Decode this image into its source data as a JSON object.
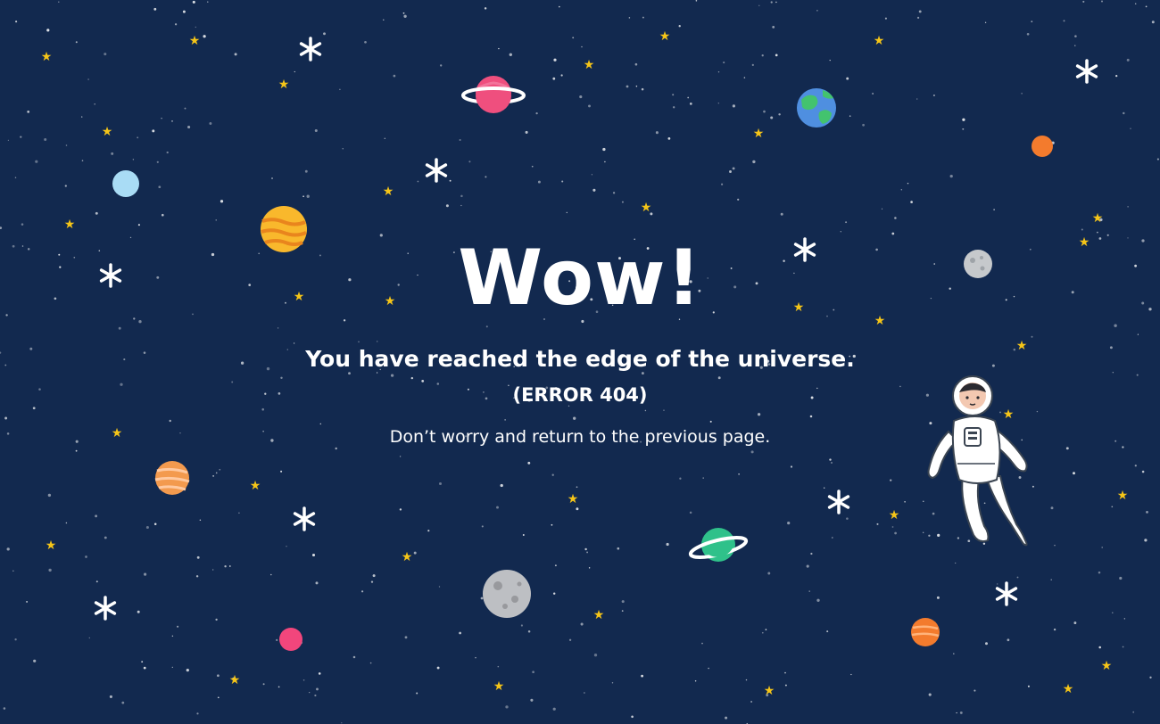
{
  "message": {
    "headline": "Wow!",
    "subline": "You have reached the edge of the universe.",
    "error": "(ERROR 404)",
    "hint": "Don’t worry and return to the previous page."
  },
  "colors": {
    "background": "#12294f",
    "text": "#ffffff",
    "star_yellow": "#f5c518",
    "star_white": "#ffffff"
  },
  "icons": [
    "ringed-planet-icon",
    "earth-icon",
    "moon-icon",
    "astronaut-illustration",
    "sparkle-star-icon"
  ]
}
